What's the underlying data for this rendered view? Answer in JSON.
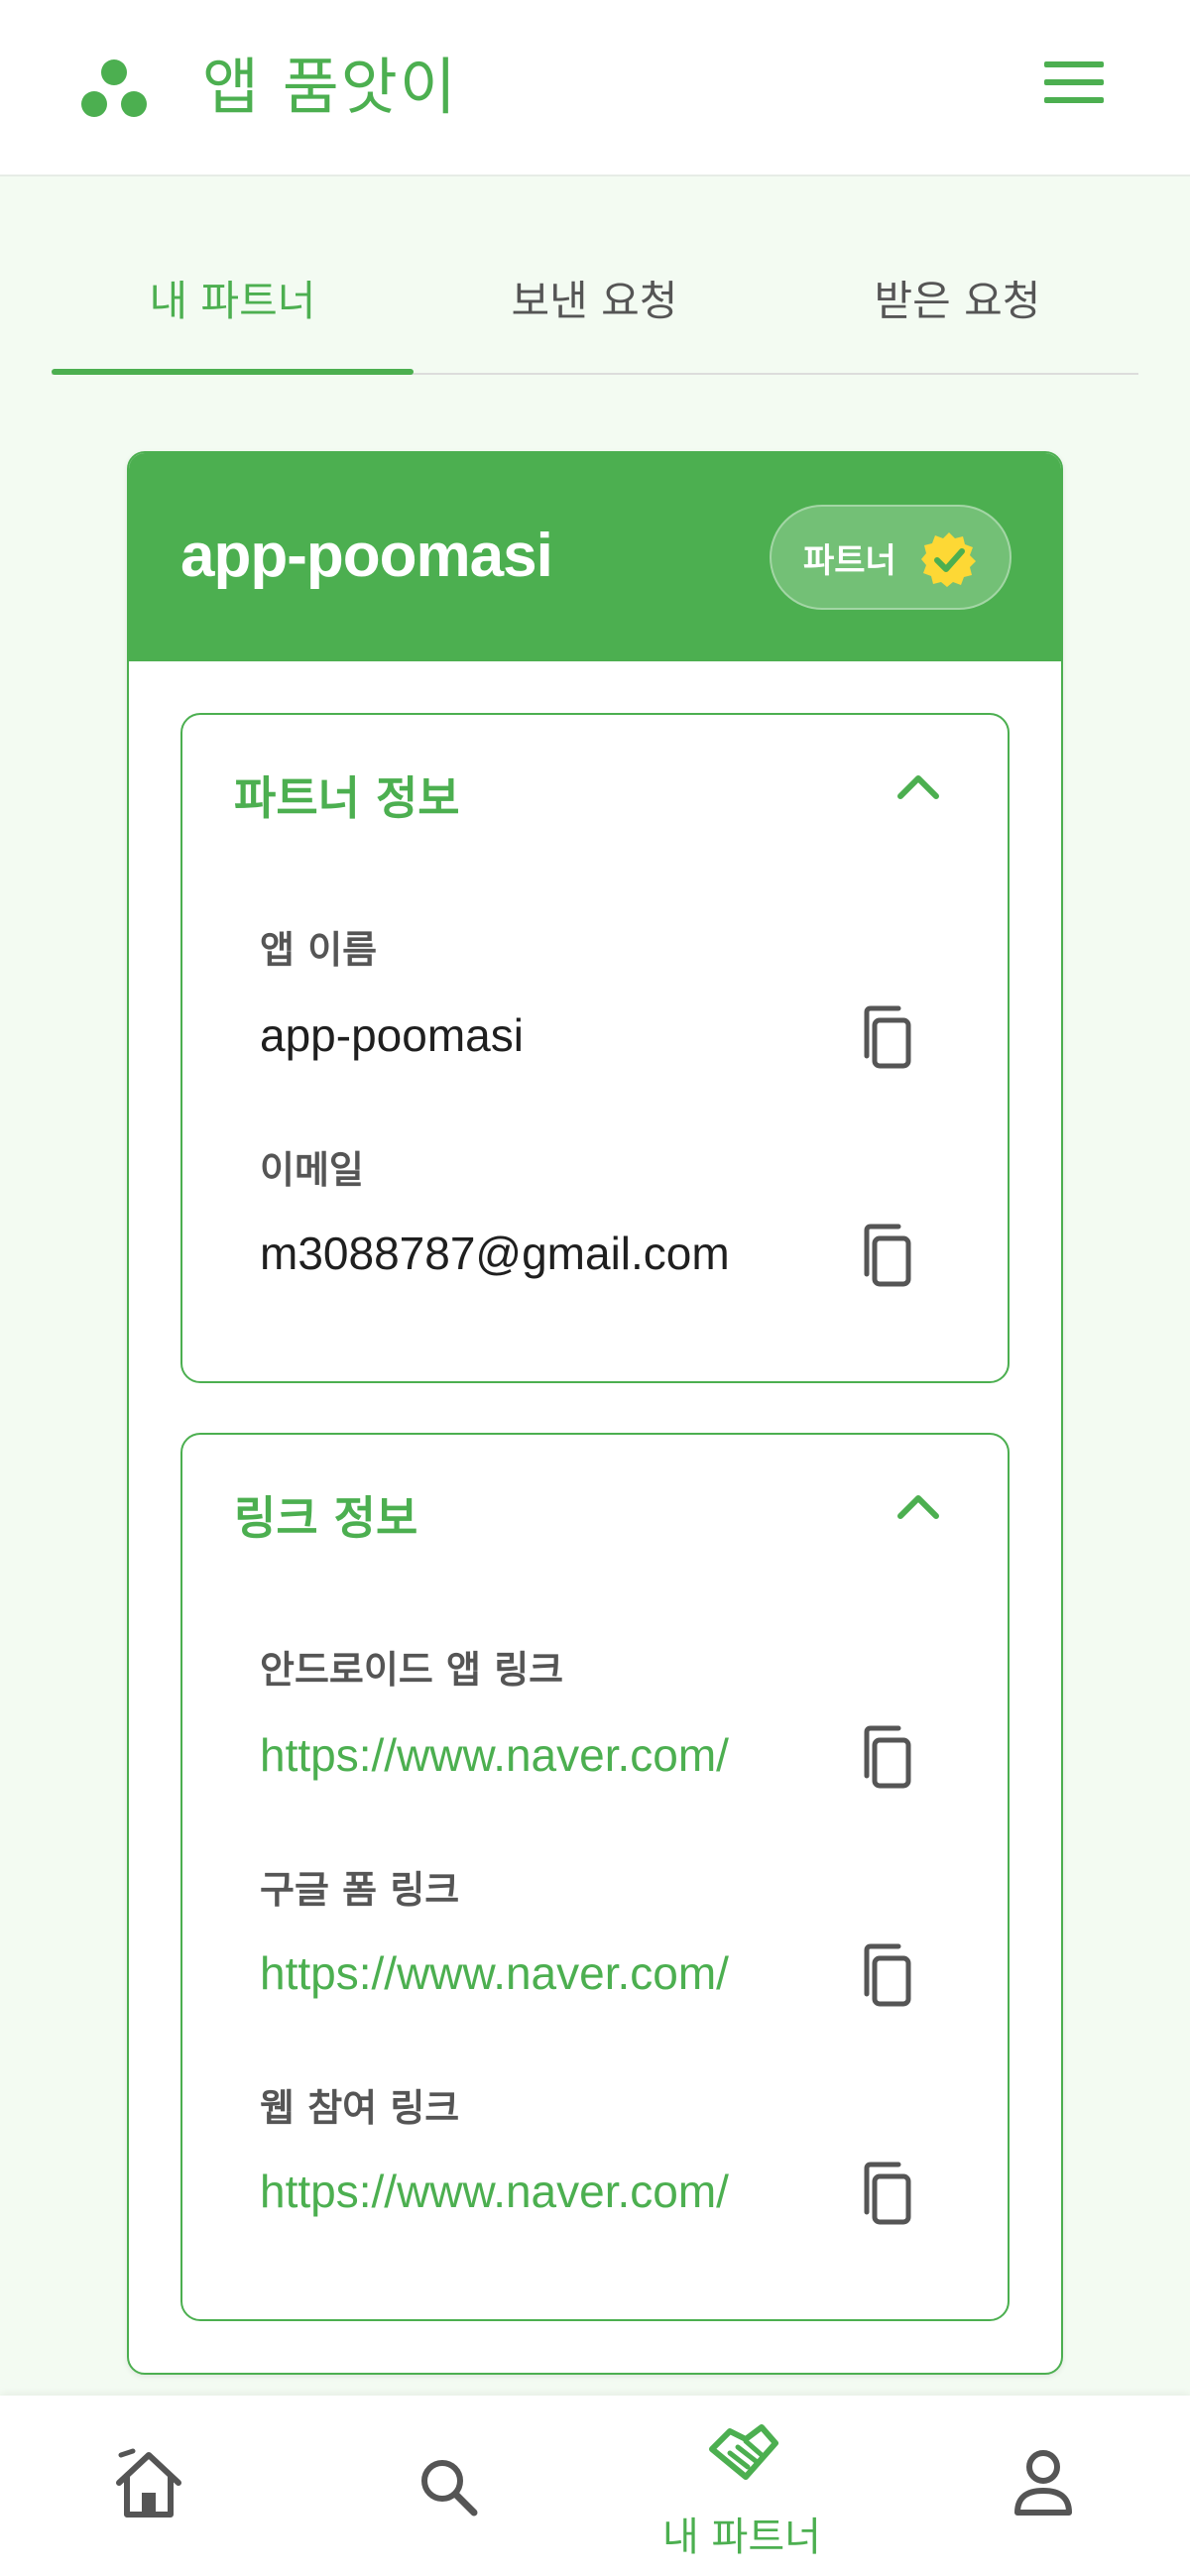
{
  "header": {
    "app_title": "앱 품앗이",
    "logo_icon": "three-dots-logo-icon",
    "menu_icon": "hamburger-menu-icon"
  },
  "tabs": [
    {
      "label": "내 파트너",
      "active": true
    },
    {
      "label": "보낸 요청",
      "active": false
    },
    {
      "label": "받은 요청",
      "active": false
    }
  ],
  "card": {
    "title": "app-poomasi",
    "badge_label": "파트너",
    "badge_icon": "verified-check-icon"
  },
  "partner_info": {
    "title": "파트너 정보",
    "fields": [
      {
        "label": "앱 이름",
        "value": "app-poomasi"
      },
      {
        "label": "이메일",
        "value": "m3088787@gmail.com"
      }
    ]
  },
  "link_info": {
    "title": "링크 정보",
    "fields": [
      {
        "label": "안드로이드 앱 링크",
        "value": "https://www.naver.com/"
      },
      {
        "label": "구글 폼 링크",
        "value": "https://www.naver.com/"
      },
      {
        "label": "웹 참여 링크",
        "value": "https://www.naver.com/"
      }
    ]
  },
  "bottom_nav": {
    "active_label": "내 파트너",
    "items": [
      {
        "icon": "home-icon"
      },
      {
        "icon": "search-icon"
      },
      {
        "icon": "handshake-icon",
        "label": "내 파트너"
      },
      {
        "icon": "person-icon"
      }
    ]
  },
  "colors": {
    "accent": "#4caf50",
    "background": "#f3fbf2",
    "badge_star": "#fdd835"
  }
}
